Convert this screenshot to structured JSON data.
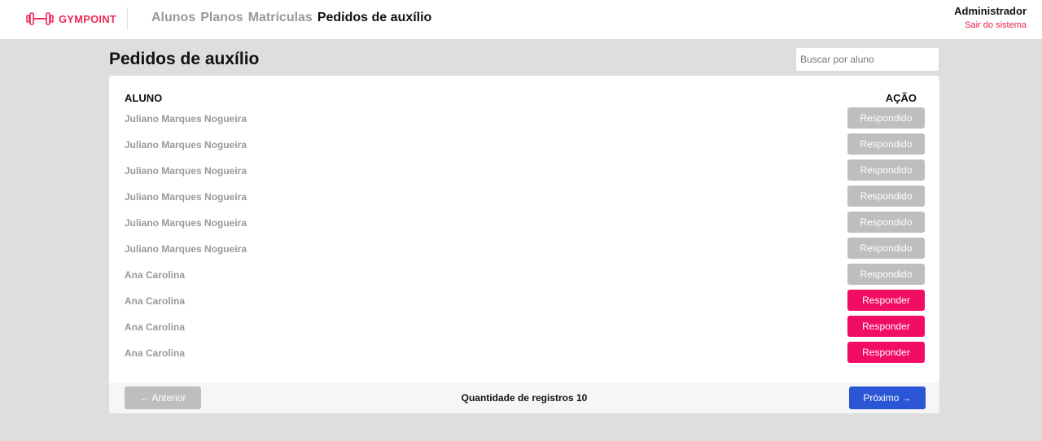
{
  "header": {
    "brand": "GYMPOINT",
    "nav": [
      {
        "label": "Alunos",
        "active": false
      },
      {
        "label": "Planos",
        "active": false
      },
      {
        "label": "Matrículas",
        "active": false
      },
      {
        "label": "Pedidos de auxílio",
        "active": true
      }
    ],
    "user_name": "Administrador",
    "logout_label": "Sair do sistema"
  },
  "page": {
    "title": "Pedidos de auxílio",
    "search_placeholder": "Buscar por aluno"
  },
  "table": {
    "col_student": "ALUNO",
    "col_action": "AÇÃO",
    "rows": [
      {
        "student": "Juliano Marques Nogueira",
        "action": "Respondido",
        "answered": true
      },
      {
        "student": "Juliano Marques Nogueira",
        "action": "Respondido",
        "answered": true
      },
      {
        "student": "Juliano Marques Nogueira",
        "action": "Respondido",
        "answered": true
      },
      {
        "student": "Juliano Marques Nogueira",
        "action": "Respondido",
        "answered": true
      },
      {
        "student": "Juliano Marques Nogueira",
        "action": "Respondido",
        "answered": true
      },
      {
        "student": "Juliano Marques Nogueira",
        "action": "Respondido",
        "answered": true
      },
      {
        "student": "Ana Carolina",
        "action": "Respondido",
        "answered": true
      },
      {
        "student": "Ana Carolina",
        "action": "Responder",
        "answered": false
      },
      {
        "student": "Ana Carolina",
        "action": "Responder",
        "answered": false
      },
      {
        "student": "Ana Carolina",
        "action": "Responder",
        "answered": false
      }
    ]
  },
  "pagination": {
    "prev_label": "← Anterior",
    "count_label": "Quantidade de registros 10",
    "next_label": "Próximo →"
  },
  "colors": {
    "brand": "#ee2b58",
    "answered": "#bcbfbd",
    "respond": "#f10d64",
    "next": "#2a55d4"
  }
}
